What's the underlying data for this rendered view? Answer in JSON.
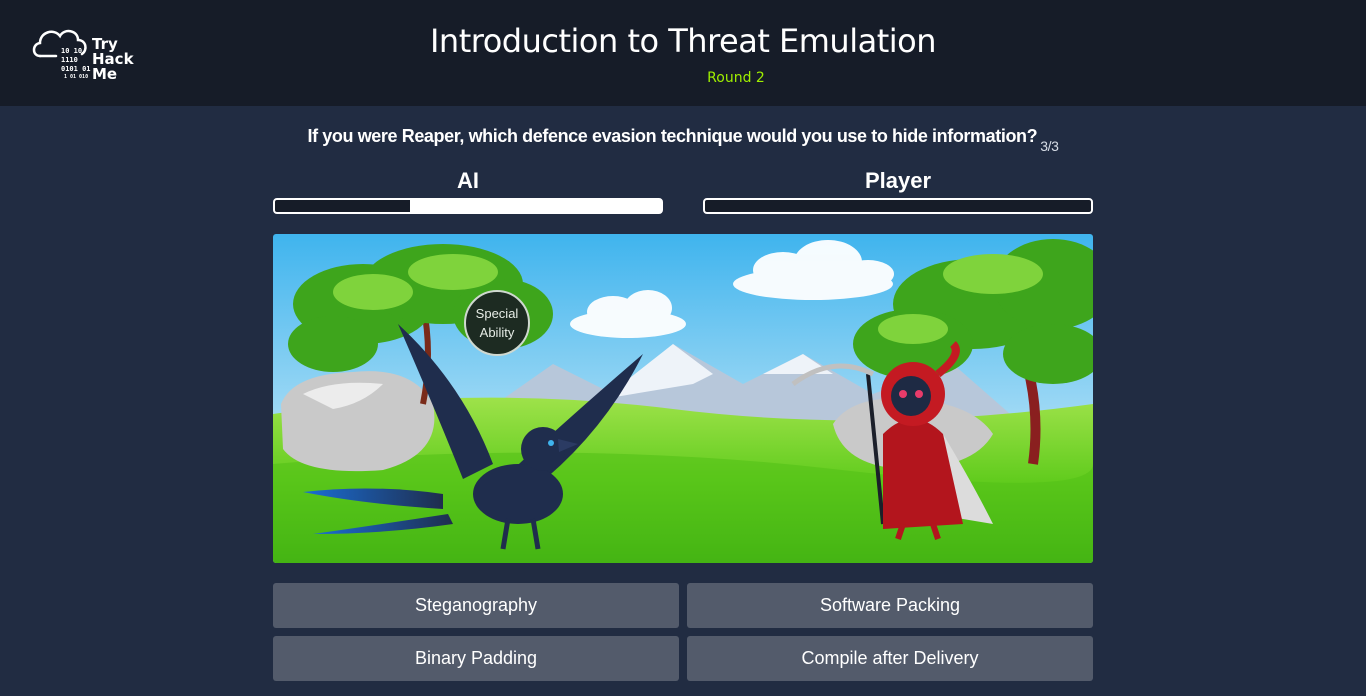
{
  "header": {
    "logo_text": "Try\nHack\nMe",
    "logo_binary": [
      "10 10",
      "1110",
      "0101 01",
      "1 01 010"
    ],
    "title": "Introduction to Threat Emulation",
    "subtitle": "Round 2"
  },
  "question": {
    "text": "If you were Reaper, which defence evasion technique would you use to hide information?",
    "counter": "3/3"
  },
  "scoreboard": {
    "ai_label": "AI",
    "player_label": "Player",
    "ai_progress_empty_fraction": 0.35,
    "player_progress_empty_fraction": 1.0
  },
  "scene": {
    "special_ability_label": "Special Ability",
    "characters": [
      "raven-creature",
      "reaper-character"
    ]
  },
  "answers": [
    "Steganography",
    "Software Packing",
    "Binary Padding",
    "Compile after Delivery"
  ],
  "colors": {
    "header_bg": "#161c28",
    "page_bg": "#212c42",
    "accent_green": "#9fef00",
    "answer_button": "#535b6b"
  }
}
